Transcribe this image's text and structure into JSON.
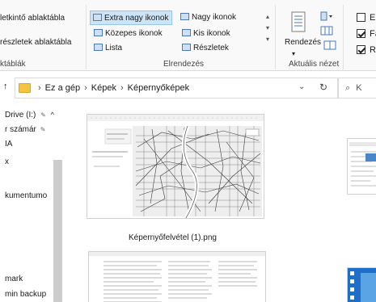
{
  "ribbon": {
    "panes": {
      "preview": "letkintő ablaktábla",
      "details": "részletek ablaktábla",
      "label": "ktáblák"
    },
    "layout": {
      "extra_large": "Extra nagy ikonok",
      "large": "Nagy ikonok",
      "medium": "Közepes ikonok",
      "small": "Kis ikonok",
      "list": "Lista",
      "details": "Részletek",
      "label": "Elrendezés"
    },
    "current_view": {
      "sort": "Rendezés",
      "label": "Aktuális nézet"
    },
    "show_hide": {
      "item1": "El",
      "item2": "Fá",
      "item3": "Re",
      "item1_checked": false,
      "item2_checked": true,
      "item3_checked": true
    }
  },
  "address": {
    "crumbs": [
      "Ez a gép",
      "Képek",
      "Képernyőképek"
    ],
    "search_placeholder": "K"
  },
  "nav": {
    "items": [
      {
        "label": "Drive (I:)"
      },
      {
        "label": "r számár"
      },
      {
        "label": "IA"
      },
      {
        "label": "x"
      },
      {
        "label": "kumentumo"
      },
      {
        "label": "mark"
      },
      {
        "label": "min backup"
      }
    ]
  },
  "content": {
    "files": [
      {
        "caption": "Képernyőfelvétel (1).png"
      }
    ]
  },
  "colors": {
    "selected_bg": "#cce4f7",
    "folder": "#f4c542",
    "nav_scrollbar": "#cdcdcd"
  }
}
